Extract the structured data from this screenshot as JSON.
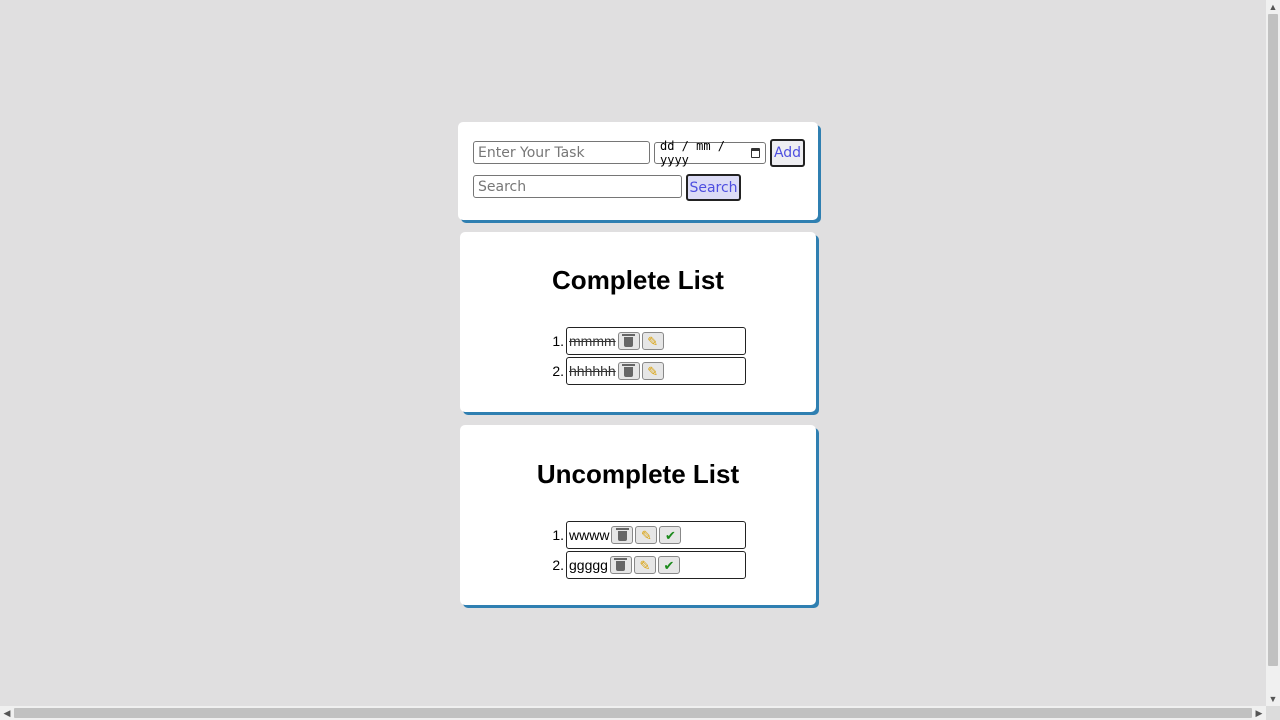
{
  "form": {
    "task_placeholder": "Enter Your Task",
    "date_placeholder": "dd / mm / yyyy",
    "add_label": "Add",
    "search_placeholder": "Search",
    "search_label": "Search"
  },
  "complete_list": {
    "title": "Complete List",
    "items": [
      {
        "number": "1.",
        "text": "mmmm"
      },
      {
        "number": "2.",
        "text": "hhhhhh"
      }
    ]
  },
  "uncomplete_list": {
    "title": "Uncomplete List",
    "items": [
      {
        "number": "1.",
        "text": "wwww"
      },
      {
        "number": "2.",
        "text": "ggggg"
      }
    ]
  },
  "icons": {
    "delete": "trash-icon",
    "edit": "pencil-icon",
    "complete": "checkmark-icon",
    "calendar": "calendar-icon"
  },
  "colors": {
    "background": "#e0dfe0",
    "card_shadow": "#2f7fb1",
    "button_text": "#4e4fe0",
    "check": "#1b8a1b",
    "pencil": "#d99e00"
  }
}
